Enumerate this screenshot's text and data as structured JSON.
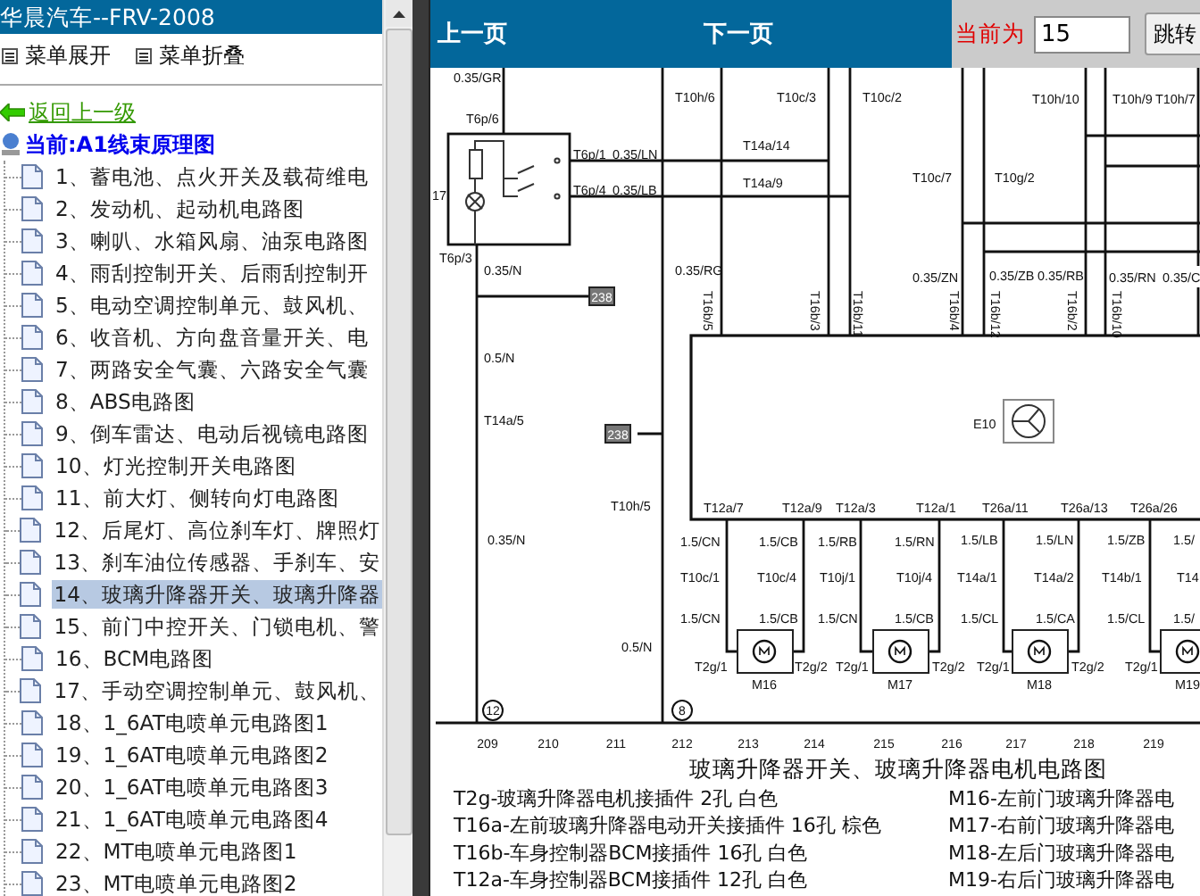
{
  "nav": {
    "title": "华晨汽车--FRV-2008",
    "menu": [
      {
        "label": "菜单展开"
      },
      {
        "label": "菜单折叠"
      }
    ],
    "back_link": "返回上一级",
    "current": {
      "label": "当前:A1线束原理图",
      "children": [
        {
          "label": "1、蓄电池、点火开关及载荷维电",
          "selected": false
        },
        {
          "label": "2、发动机、起动机电路图",
          "selected": false
        },
        {
          "label": "3、喇叭、水箱风扇、油泵电路图",
          "selected": false
        },
        {
          "label": "4、雨刮控制开关、后雨刮控制开",
          "selected": false
        },
        {
          "label": "5、电动空调控制单元、鼓风机、",
          "selected": false
        },
        {
          "label": "6、收音机、方向盘音量开关、电",
          "selected": false
        },
        {
          "label": "7、两路安全气囊、六路安全气囊",
          "selected": false
        },
        {
          "label": "8、ABS电路图",
          "selected": false
        },
        {
          "label": "9、倒车雷达、电动后视镜电路图",
          "selected": false
        },
        {
          "label": "10、灯光控制开关电路图",
          "selected": false
        },
        {
          "label": "11、前大灯、侧转向灯电路图",
          "selected": false
        },
        {
          "label": "12、后尾灯、高位刹车灯、牌照灯",
          "selected": false
        },
        {
          "label": "13、刹车油位传感器、手刹车、安",
          "selected": false
        },
        {
          "label": "14、玻璃升降器开关、玻璃升降器",
          "selected": true
        },
        {
          "label": "15、前门中控开关、门锁电机、警",
          "selected": false
        },
        {
          "label": "16、BCM电路图",
          "selected": false
        },
        {
          "label": "17、手动空调控制单元、鼓风机、",
          "selected": false
        },
        {
          "label": "18、1_6AT电喷单元电路图1",
          "selected": false
        },
        {
          "label": "19、1_6AT电喷单元电路图2",
          "selected": false
        },
        {
          "label": "20、1_6AT电喷单元电路图3",
          "selected": false
        },
        {
          "label": "21、1_6AT电喷单元电路图4",
          "selected": false
        },
        {
          "label": "22、MT电喷单元电路图1",
          "selected": false
        },
        {
          "label": "23、MT电喷单元电路图2",
          "selected": false
        }
      ]
    }
  },
  "toolbar": {
    "prev": "上一页",
    "next": "下一页",
    "page_label": "当前为",
    "page_input": {
      "value": "15"
    },
    "go_button": "跳转"
  },
  "diagram": {
    "labels": [
      "0.35/GR",
      "T6p/6",
      "T6p/1",
      "0.35/LN",
      "T6p/4",
      "0.35/LB",
      "17",
      "T6p/3",
      "0.35/N",
      "T10h/6",
      "T10c/3",
      "T10c/2",
      "T14a/14",
      "T14a/9",
      "0.35/RG",
      "T10c/7",
      "T10g/2",
      "0.35/ZN",
      "0.35/ZB",
      "0.35/RB",
      "0.35/RN",
      "0.35/C",
      "T10h/10",
      "T10h/9",
      "T10h/7",
      "T16b/5",
      "T16b/3",
      "T16b/11",
      "T16b/4",
      "T16b/12",
      "T16b/2",
      "T16b/10",
      "0.5/N",
      "T14a/5",
      "E10",
      "T10h/5",
      "0.35/N",
      "0.5/N",
      "T12a/7",
      "T12a/9",
      "T12a/3",
      "T12a/1",
      "T26a/11",
      "T26a/13",
      "T26a/26",
      "1.5/CN",
      "1.5/CB",
      "1.5/RB",
      "1.5/RN",
      "1.5/LB",
      "1.5/LN",
      "1.5/ZB",
      "1.5/",
      "T10c/1",
      "T10c/4",
      "T10j/1",
      "T10j/4",
      "T14a/1",
      "T14a/2",
      "T14b/1",
      "T14",
      "1.5/CN",
      "1.5/CB",
      "1.5/CN",
      "1.5/CB",
      "1.5/CL",
      "1.5/CA",
      "1.5/CL",
      "1.5/",
      "T2g/1",
      "T2g/2",
      "T2g/1",
      "T2g/2",
      "T2g/1",
      "T2g/2",
      "T2g/1"
    ],
    "ground_tags": [
      "238",
      "238"
    ],
    "references": [
      "12",
      "8"
    ],
    "motors": [
      "M16",
      "M17",
      "M18",
      "M19"
    ],
    "column_numbers": [
      "209",
      "210",
      "211",
      "212",
      "213",
      "214",
      "215",
      "216",
      "217",
      "218",
      "219"
    ],
    "title": "玻璃升降器开关、玻璃升降器电机电路图",
    "legend_left": [
      "T2g-玻璃升降器电机接插件 2孔 白色",
      "T16a-左前玻璃升降器电动开关接插件 16孔 棕色",
      "T16b-车身控制器BCM接插件 16孔 白色",
      "T12a-车身控制器BCM接插件 12孔 白色"
    ],
    "legend_right": [
      "M16-左前门玻璃升降器电",
      "M17-右前门玻璃升降器电",
      "M18-左后门玻璃升降器电",
      "M19-右后门玻璃升降器电"
    ]
  }
}
